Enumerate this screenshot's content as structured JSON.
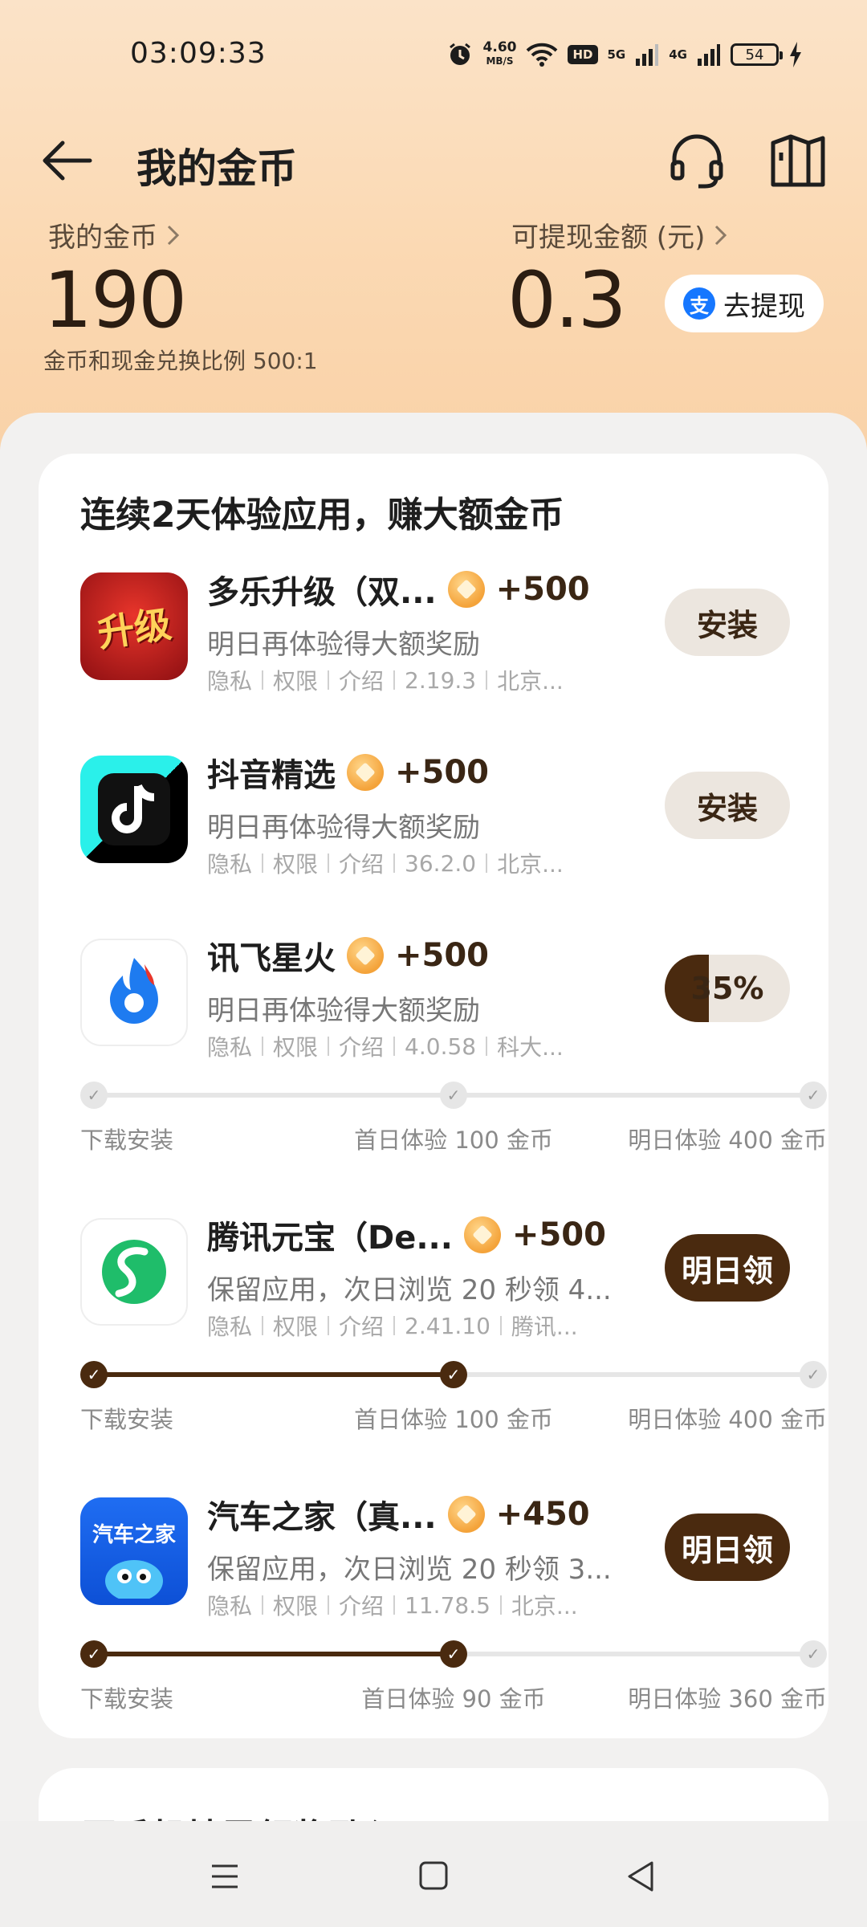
{
  "status_bar": {
    "time": "03:09:33",
    "net_speed": "4.60",
    "net_speed_unit": "MB/S",
    "hd_badge": "HD",
    "signal_1": "5G",
    "signal_2": "4G",
    "battery": "54"
  },
  "header": {
    "title": "我的金币"
  },
  "summary": {
    "coins_label": "我的金币",
    "coins_value": "190",
    "rate_text": "金币和现金兑换比例 500:1",
    "cash_label": "可提现金额 (元)",
    "cash_value": "0.3",
    "withdraw_label": "去提现",
    "alipay_glyph": "支"
  },
  "task_card": {
    "title": "连续2天体验应用，赚大额金币",
    "meta_labels": [
      "隐私",
      "权限",
      "介绍"
    ],
    "apps": [
      {
        "name": "多乐升级（双...",
        "reward": "+500",
        "desc": "明日再体验得大额奖励",
        "version": "2.19.3",
        "developer": "北京...",
        "action": "安装",
        "icon_text": "升级"
      },
      {
        "name": "抖音精选",
        "reward": "+500",
        "desc": "明日再体验得大额奖励",
        "version": "36.2.0",
        "developer": "北京...",
        "action": "安装"
      },
      {
        "name": "讯飞星火",
        "reward": "+500",
        "desc": "明日再体验得大额奖励",
        "version": "4.0.58",
        "developer": "科大...",
        "action": "35%",
        "progress": 0.35,
        "steps": [
          "下载安装",
          "首日体验 100 金币",
          "明日体验 400 金币"
        ],
        "steps_done": 0
      },
      {
        "name": "腾讯元宝（De...",
        "reward": "+500",
        "desc": "保留应用，次日浏览 20 秒领 4...",
        "version": "2.41.10",
        "developer": "腾讯...",
        "action": "明日领",
        "steps": [
          "下载安装",
          "首日体验 100 金币",
          "明日体验 400 金币"
        ],
        "steps_done": 2
      },
      {
        "name": "汽车之家（真...",
        "reward": "+450",
        "desc": "保留应用，次日浏览 20 秒领 3...",
        "version": "11.78.5",
        "developer": "北京...",
        "action": "明日领",
        "icon_text": "汽车之家",
        "steps": [
          "下载安装",
          "首日体验 90 金币",
          "明日体验 360 金币"
        ],
        "steps_done": 2
      }
    ]
  },
  "next_card": {
    "title": "原手机精灵领奖励入口"
  },
  "colors": {
    "accent_dark": "#4a2a0f",
    "header_gradient_top": "#fbe3c8",
    "alipay_blue": "#1677ff"
  }
}
